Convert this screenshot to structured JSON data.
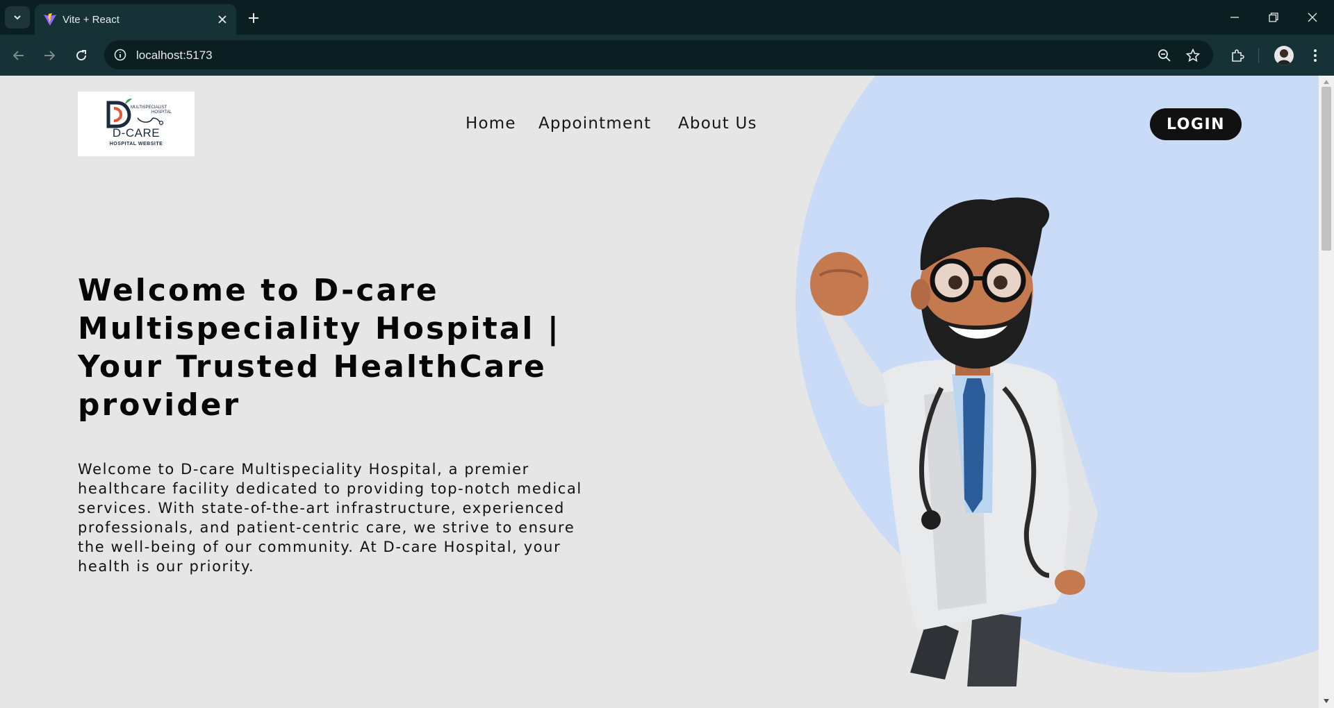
{
  "browser": {
    "tab_title": "Vite + React",
    "url": "localhost:5173",
    "accent_color": "#163236"
  },
  "site": {
    "logo": {
      "name": "D-CARE",
      "tagline": "HOSPITAL WEBSITE",
      "badge_line1": "MULTISPECIALIST",
      "badge_line2": "HOSPITAL"
    },
    "nav": {
      "home": "Home",
      "appointment": "Appointment",
      "about": "About Us",
      "login": "LOGIN"
    },
    "hero": {
      "title": "Welcome to D-care Multispeciality Hospital | Your Trusted HealthCare provider",
      "text": "Welcome to D-care Multispeciality Hospital, a premier healthcare facility dedicated to providing top-notch medical services. With state-of-the-art infrastructure, experienced professionals, and patient-centric care, we strive to ensure the well-being of our community. At D-care Hospital, your health is our priority."
    },
    "colors": {
      "page_bg": "#e6e6e6",
      "blob": "#c9dbf7",
      "button_bg": "#111111",
      "text": "#050505"
    }
  }
}
